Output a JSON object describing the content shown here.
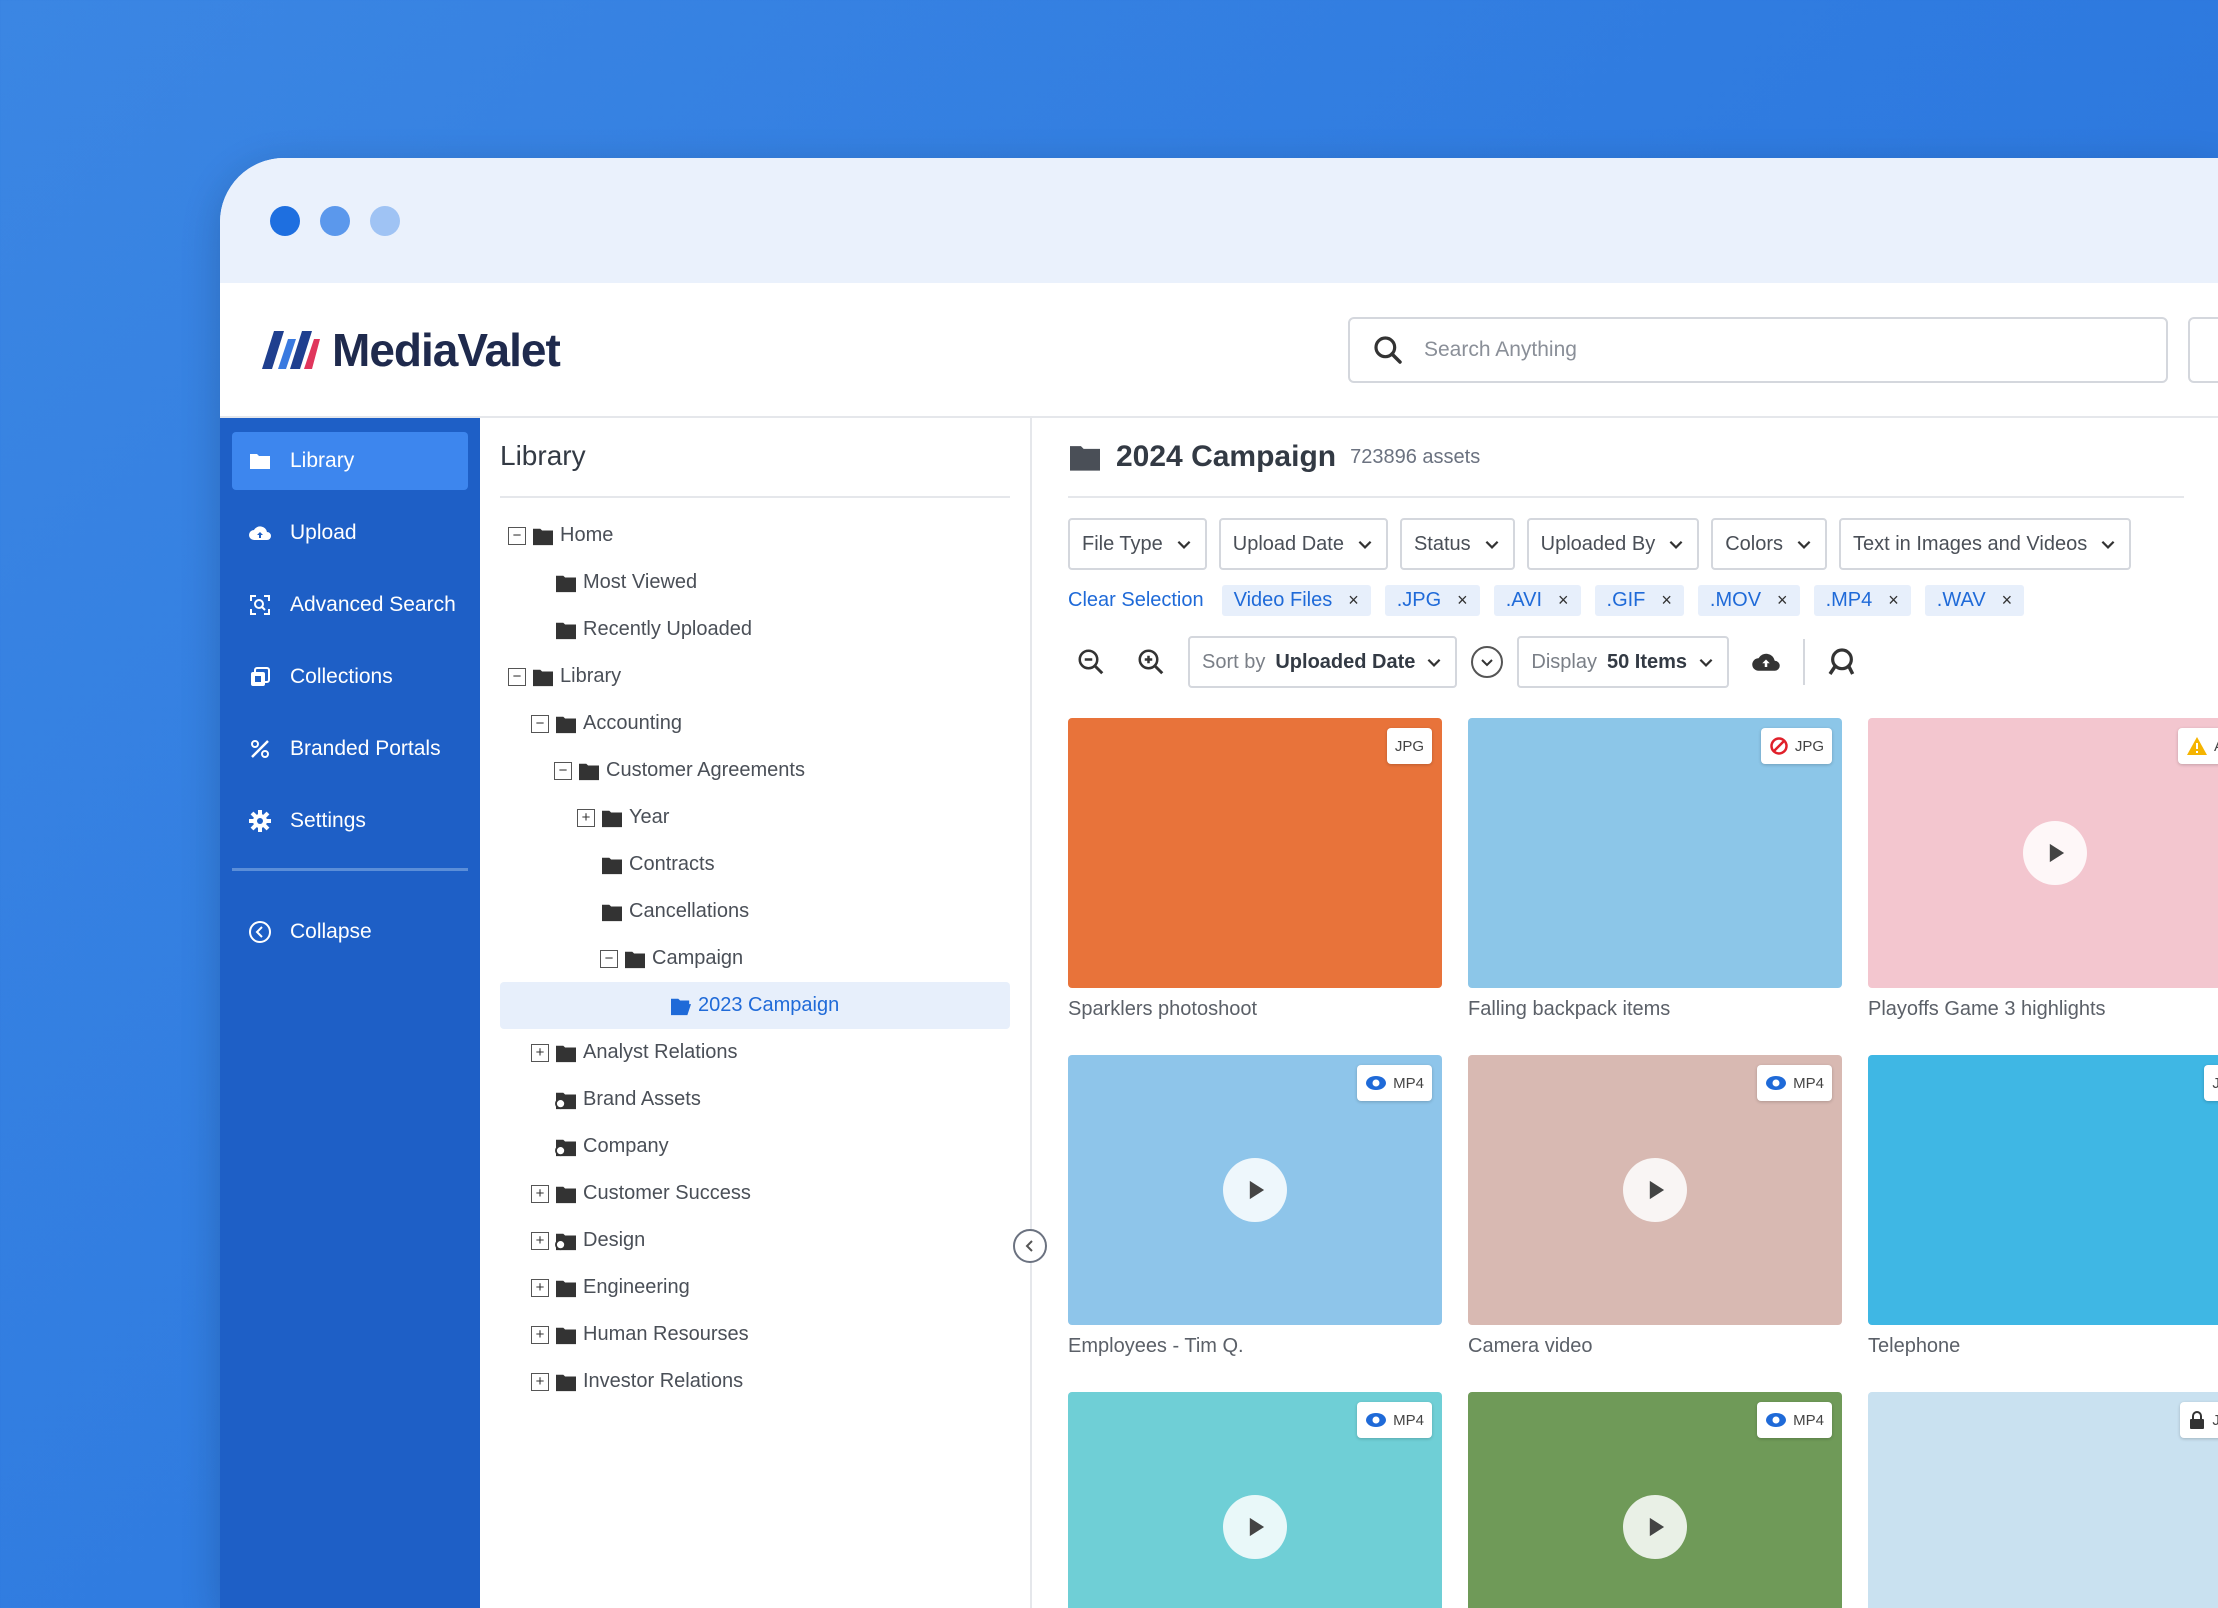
{
  "app": {
    "name": "MediaValet",
    "search_placeholder": "Search Anything"
  },
  "sidebar": {
    "items": [
      {
        "label": "Library",
        "icon": "folder-icon",
        "active": true
      },
      {
        "label": "Upload",
        "icon": "cloud-upload-icon",
        "active": false
      },
      {
        "label": "Advanced Search",
        "icon": "advanced-search-icon",
        "active": false
      },
      {
        "label": "Collections",
        "icon": "collections-icon",
        "active": false
      },
      {
        "label": "Branded Portals",
        "icon": "branded-portals-icon",
        "active": false
      },
      {
        "label": "Settings",
        "icon": "gear-icon",
        "active": false
      }
    ],
    "collapse_label": "Collapse"
  },
  "tree": {
    "title": "Library",
    "rows": [
      {
        "label": "Home",
        "toggle": "minus",
        "indent": 0,
        "icon": "folder"
      },
      {
        "label": "Most Viewed",
        "toggle": "none",
        "indent": 1,
        "icon": "folder"
      },
      {
        "label": "Recently Uploaded",
        "toggle": "none",
        "indent": 1,
        "icon": "folder"
      },
      {
        "label": "Library",
        "toggle": "minus",
        "indent": 0,
        "icon": "folder"
      },
      {
        "label": "Accounting",
        "toggle": "minus",
        "indent": 1,
        "icon": "folder"
      },
      {
        "label": "Customer Agreements",
        "toggle": "minus",
        "indent": 2,
        "icon": "folder"
      },
      {
        "label": "Year",
        "toggle": "plus",
        "indent": 3,
        "icon": "folder"
      },
      {
        "label": "Contracts",
        "toggle": "none",
        "indent": 3,
        "icon": "folder"
      },
      {
        "label": "Cancellations",
        "toggle": "none",
        "indent": 3,
        "icon": "folder"
      },
      {
        "label": "Campaign",
        "toggle": "minus",
        "indent": 4,
        "icon": "folder"
      },
      {
        "label": "2023 Campaign",
        "toggle": "none",
        "indent": 6,
        "icon": "folder-open",
        "selected": true
      },
      {
        "label": "Analyst Relations",
        "toggle": "plus",
        "indent": 1,
        "icon": "folder"
      },
      {
        "label": "Brand Assets",
        "toggle": "none",
        "indent": 1,
        "icon": "shared-folder"
      },
      {
        "label": "Company",
        "toggle": "none",
        "indent": 1,
        "icon": "shared-folder"
      },
      {
        "label": "Customer Success",
        "toggle": "plus",
        "indent": 1,
        "icon": "folder"
      },
      {
        "label": "Design",
        "toggle": "plus",
        "indent": 1,
        "icon": "shared-folder"
      },
      {
        "label": "Engineering",
        "toggle": "plus",
        "indent": 1,
        "icon": "folder"
      },
      {
        "label": "Human Resourses",
        "toggle": "plus",
        "indent": 1,
        "icon": "folder"
      },
      {
        "label": "Investor Relations",
        "toggle": "plus",
        "indent": 1,
        "icon": "folder"
      }
    ]
  },
  "main": {
    "title": "2024 Campaign",
    "asset_count": "723896 assets",
    "filters": [
      "File Type",
      "Upload Date",
      "Status",
      "Uploaded By",
      "Colors",
      "Text in Images and Videos"
    ],
    "clear_selection": "Clear Selection",
    "chips": [
      "Video Files",
      ".JPG",
      ".AVI",
      ".GIF",
      ".MOV",
      ".MP4",
      ".WAV"
    ],
    "sort_prefix": "Sort by",
    "sort_value": "Uploaded Date",
    "display_prefix": "Display",
    "display_value": "50 Items",
    "cards": [
      {
        "title": "Sparklers photoshoot",
        "badge": "JPG",
        "badge_icon": "",
        "play": false,
        "bg": "#e8733a"
      },
      {
        "title": "Falling backpack items",
        "badge": "JPG",
        "badge_icon": "blocked-icon",
        "play": false,
        "bg": "#8cc6e8"
      },
      {
        "title": "Playoffs Game 3 highlights",
        "badge": "A",
        "badge_icon": "warning-icon",
        "play": true,
        "bg": "#f3c6cf"
      },
      {
        "title": "Employees - Tim Q.",
        "badge": "MP4",
        "badge_icon": "eye-icon",
        "play": true,
        "bg": "#8ec5ea"
      },
      {
        "title": "Camera video",
        "badge": "MP4",
        "badge_icon": "eye-icon",
        "play": true,
        "bg": "#d8b9b2"
      },
      {
        "title": "Telephone",
        "badge": "JI",
        "badge_icon": "",
        "play": false,
        "bg": "#3fb7e4"
      },
      {
        "title": "",
        "badge": "MP4",
        "badge_icon": "eye-icon",
        "play": true,
        "bg": "#6fcfd6"
      },
      {
        "title": "",
        "badge": "MP4",
        "badge_icon": "eye-icon",
        "play": true,
        "bg": "#6f9a58"
      },
      {
        "title": "",
        "badge": "JI",
        "badge_icon": "lock-icon",
        "play": false,
        "bg": "#c9e1f0"
      }
    ]
  },
  "colors": {
    "sidebar": "#1e5fc6",
    "sidebar_active": "#3d86ee",
    "accent": "#1f6ad8",
    "dot1": "#1e6fe0",
    "dot2": "#5b98ec",
    "dot3": "#9fc3f4"
  }
}
